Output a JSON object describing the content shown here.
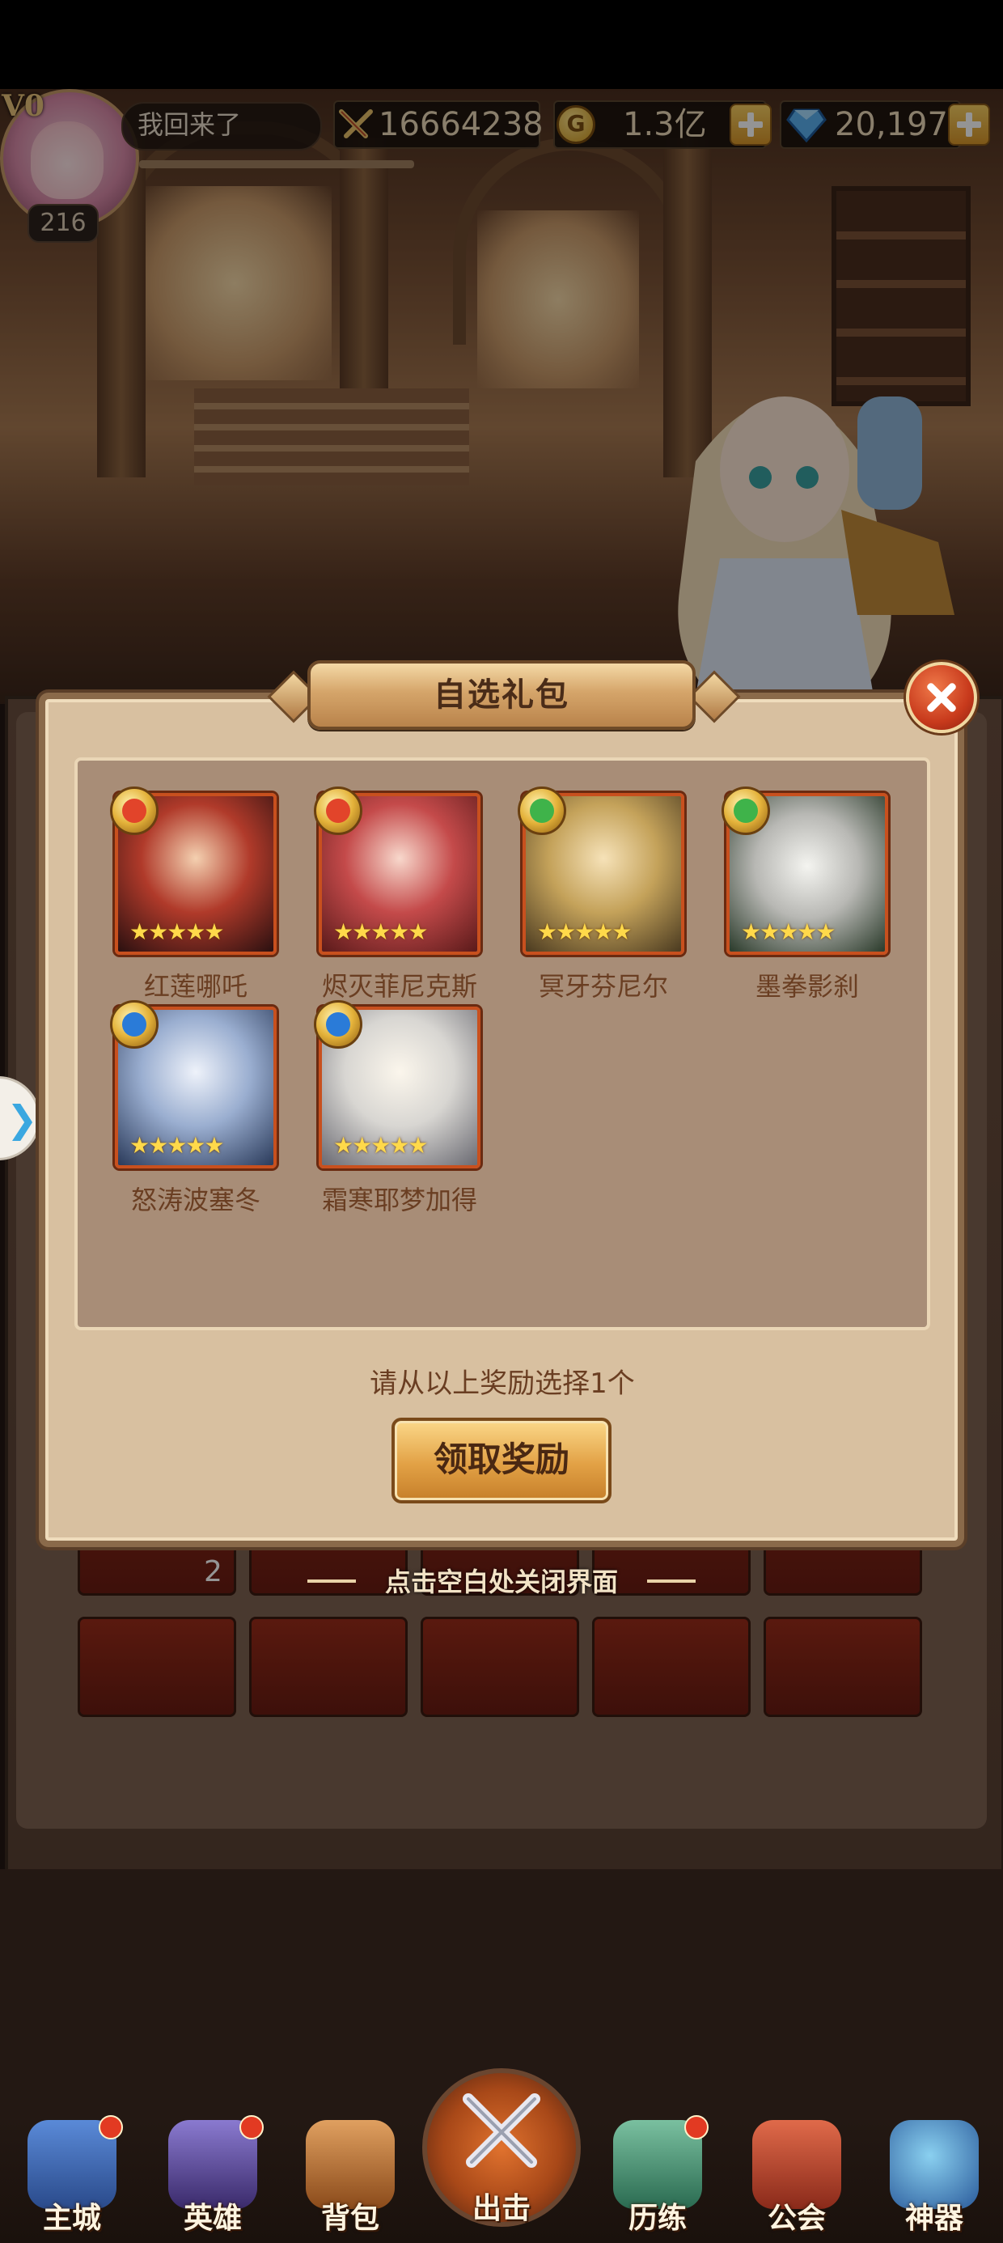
{
  "player": {
    "vip": "V0",
    "level": "216",
    "name": "我回来了",
    "power": "16664238",
    "gold": "1.3亿",
    "gems": "20,197"
  },
  "icons": {
    "power": "crossed-swords-icon",
    "gold": "gold-coin-icon",
    "gems": "diamond-icon",
    "add": "plus-icon",
    "close": "close-x-icon"
  },
  "dialog": {
    "title": "自选礼包",
    "prompt": "请从以上奖励选择1个",
    "claim_label": "领取奖励",
    "tap_close_hint": "点击空白处关闭界面",
    "heroes": [
      {
        "name": "红莲哪吒",
        "element": "fire",
        "stars": 5
      },
      {
        "name": "烬灭菲尼克斯",
        "element": "fire",
        "stars": 5
      },
      {
        "name": "冥牙芬尼尔",
        "element": "wind",
        "stars": 5
      },
      {
        "name": "墨拳影刹",
        "element": "wind",
        "stars": 5
      },
      {
        "name": "怒涛波塞冬",
        "element": "water",
        "stars": 5
      },
      {
        "name": "霜寒耶梦加得",
        "element": "water",
        "stars": 5
      }
    ]
  },
  "background_panel": {
    "slot_count_visible": "2"
  },
  "nav": {
    "items": [
      {
        "label": "主城",
        "badge": true
      },
      {
        "label": "英雄",
        "badge": true
      },
      {
        "label": "背包",
        "badge": false
      },
      {
        "label": "出击",
        "badge": false
      },
      {
        "label": "历练",
        "badge": true
      },
      {
        "label": "公会",
        "badge": false
      },
      {
        "label": "神器",
        "badge": false
      }
    ]
  },
  "colors": {
    "fire": "#e2442a",
    "wind": "#3fb34a",
    "water": "#2a7bd8",
    "accent_gold": "#e2a145",
    "close_red": "#c83a1c"
  }
}
